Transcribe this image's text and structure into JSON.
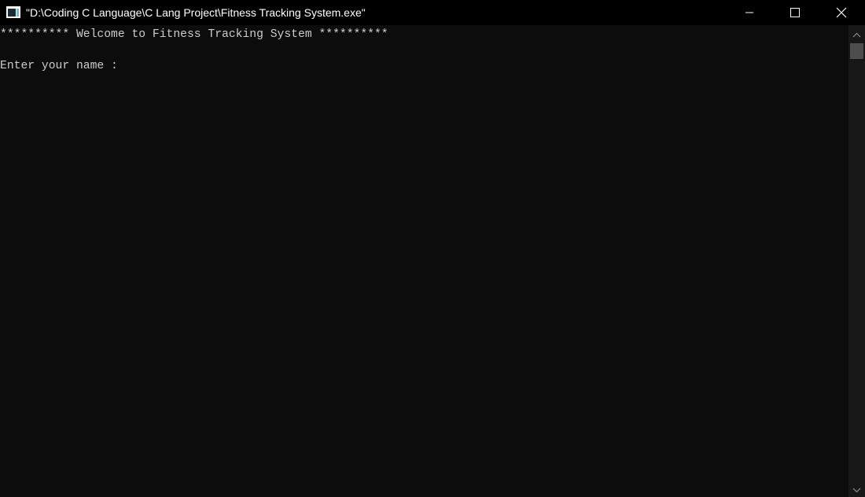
{
  "window": {
    "title": "\"D:\\Coding C Language\\C Lang Project\\Fitness Tracking System.exe\"",
    "icon": "console-app-icon",
    "buttons": {
      "minimize": "minimize-icon",
      "maximize": "maximize-icon",
      "close": "close-icon"
    }
  },
  "console": {
    "lines": [
      "********** Welcome to Fitness Tracking System **********",
      "Enter your name : "
    ],
    "background": "#0c0c0c",
    "foreground": "#cccccc"
  },
  "scrollbar": {
    "up_icon": "scroll-up-arrow-icon",
    "down_icon": "scroll-down-arrow-icon"
  }
}
